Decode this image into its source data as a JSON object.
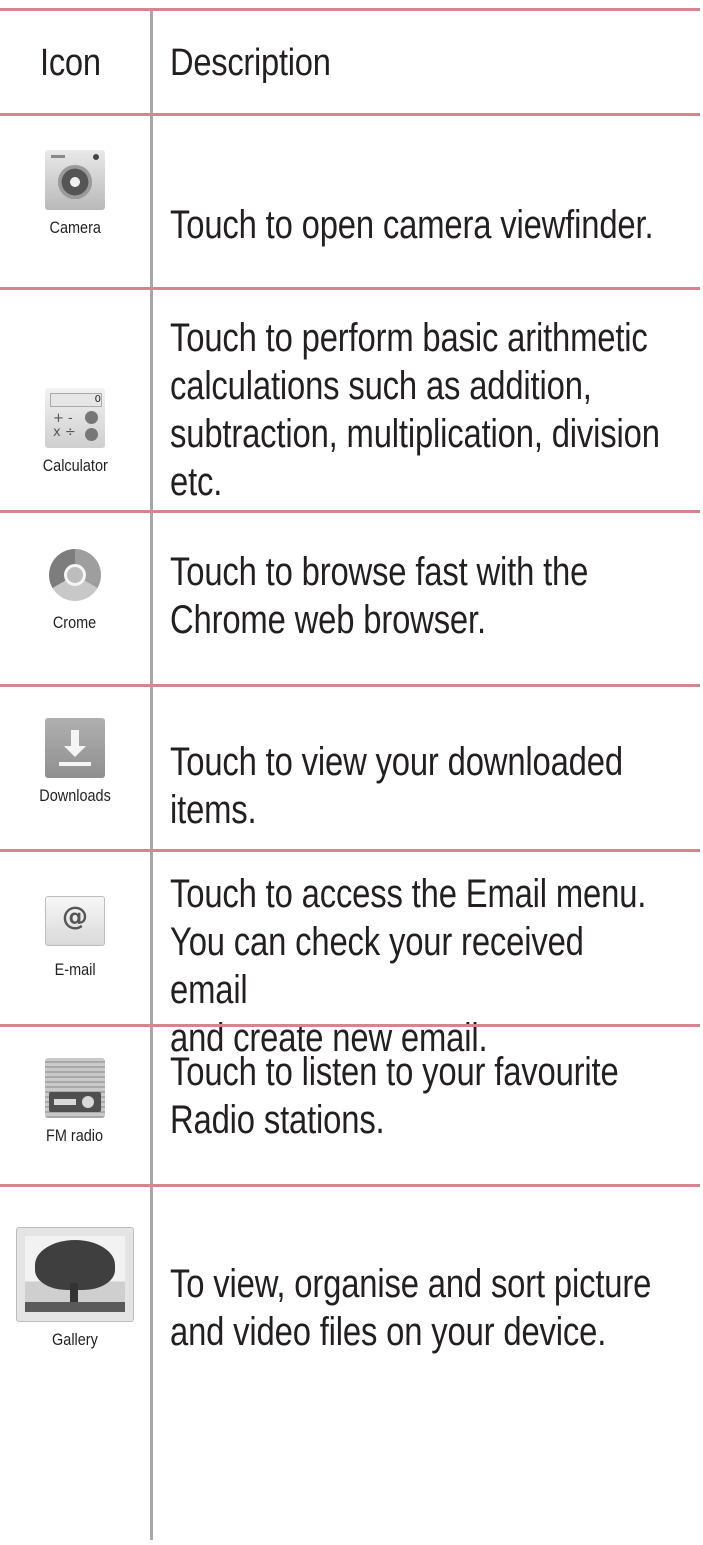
{
  "header": {
    "icon_col": "Icon",
    "description_col": "Description"
  },
  "rows": [
    {
      "icon": "camera-icon",
      "caption": "Camera",
      "description": "Touch to open camera viewfinder."
    },
    {
      "icon": "calculator-icon",
      "caption": "Calculator",
      "description": "Touch to perform basic arithmetic\ncalculations such as addition,\nsubtraction, multiplication, division\netc."
    },
    {
      "icon": "chrome-icon",
      "caption": "Crome",
      "description": "Touch to browse fast with the\nChrome web browser."
    },
    {
      "icon": "download-icon",
      "caption": "Downloads",
      "description": "Touch to view your downloaded\nitems."
    },
    {
      "icon": "email-icon",
      "caption": "E-mail",
      "description": "Touch to access the Email menu.\nYou can check your received email\nand create new email."
    },
    {
      "icon": "radio-icon",
      "caption": "FM radio",
      "description": "Touch to listen to your  favourite\nRadio stations."
    },
    {
      "icon": "gallery-icon",
      "caption": "Gallery",
      "description": "To view, organise and sort picture\nand video files on your device."
    }
  ],
  "colors": {
    "row_divider": "#d4858e",
    "column_divider": "#a8a7a7",
    "text": "#231f20"
  }
}
